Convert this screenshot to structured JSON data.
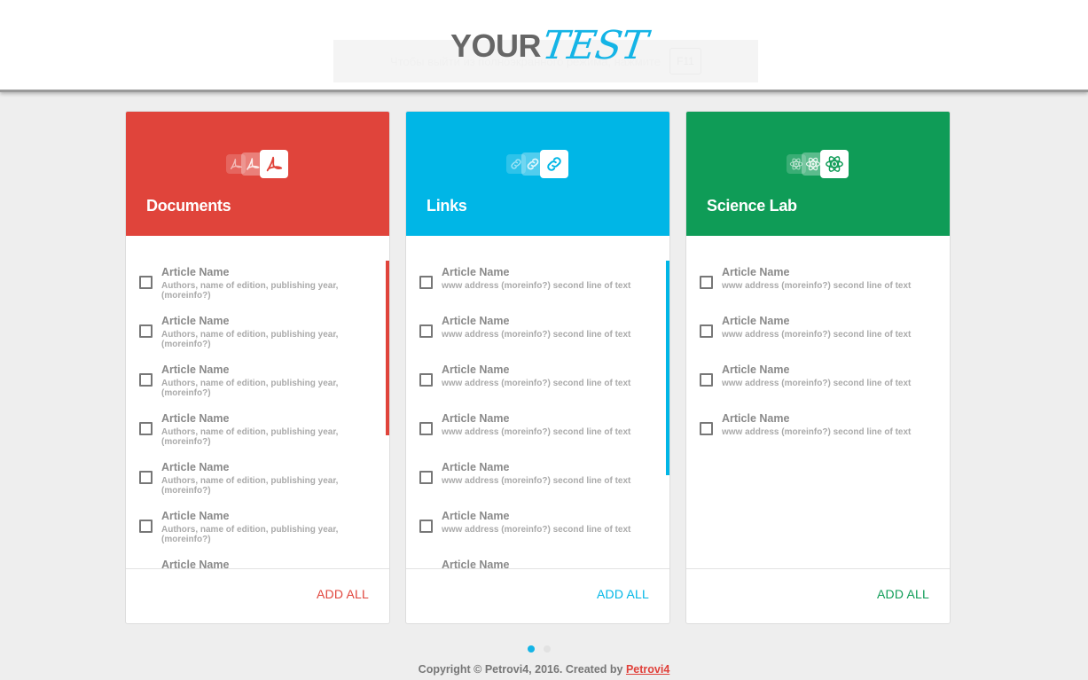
{
  "header": {
    "logo_your": "YOUR",
    "logo_test": "TEST",
    "notice_text": "Чтобы выйти из полноэкранного режима, нажмите",
    "notice_key": "F11"
  },
  "colors": {
    "documents": "#e0443b",
    "links": "#00b6e6",
    "science": "#0f9c57"
  },
  "cards": [
    {
      "title": "Documents",
      "icon": "pdf-icon",
      "add_all": "ADD ALL",
      "items": [
        {
          "title": "Article Name",
          "sub": "Authors, name of edition, publishing year, (moreinfo?)"
        },
        {
          "title": "Article Name",
          "sub": "Authors, name of edition, publishing year, (moreinfo?)"
        },
        {
          "title": "Article Name",
          "sub": "Authors, name of edition, publishing year, (moreinfo?)"
        },
        {
          "title": "Article Name",
          "sub": "Authors, name of edition, publishing year, (moreinfo?)"
        },
        {
          "title": "Article Name",
          "sub": "Authors, name of edition, publishing year, (moreinfo?)"
        },
        {
          "title": "Article Name",
          "sub": "Authors, name of edition, publishing year, (moreinfo?)"
        },
        {
          "title": "Article Name",
          "sub": ""
        }
      ]
    },
    {
      "title": "Links",
      "icon": "link-icon",
      "add_all": "ADD ALL",
      "items": [
        {
          "title": "Article Name",
          "sub": "www address (moreinfo?) second line of text"
        },
        {
          "title": "Article Name",
          "sub": "www address (moreinfo?) second line of text"
        },
        {
          "title": "Article Name",
          "sub": "www address (moreinfo?) second line of text"
        },
        {
          "title": "Article Name",
          "sub": "www address (moreinfo?) second line of text"
        },
        {
          "title": "Article Name",
          "sub": "www address (moreinfo?) second line of text"
        },
        {
          "title": "Article Name",
          "sub": "www address (moreinfo?) second line of text"
        },
        {
          "title": "Article Name",
          "sub": ""
        }
      ]
    },
    {
      "title": "Science Lab",
      "icon": "atom-icon",
      "add_all": "ADD ALL",
      "items": [
        {
          "title": "Article Name",
          "sub": "www address (moreinfo?) second line of text"
        },
        {
          "title": "Article Name",
          "sub": "www address (moreinfo?) second line of text"
        },
        {
          "title": "Article Name",
          "sub": "www address (moreinfo?) second line of text"
        },
        {
          "title": "Article Name",
          "sub": "www address (moreinfo?) second line of text"
        }
      ]
    }
  ],
  "pager": {
    "current": 1,
    "total": 2
  },
  "footer": {
    "text": "Copyright © Petrovi4, 2016. Created by",
    "link": "Petrovi4"
  }
}
